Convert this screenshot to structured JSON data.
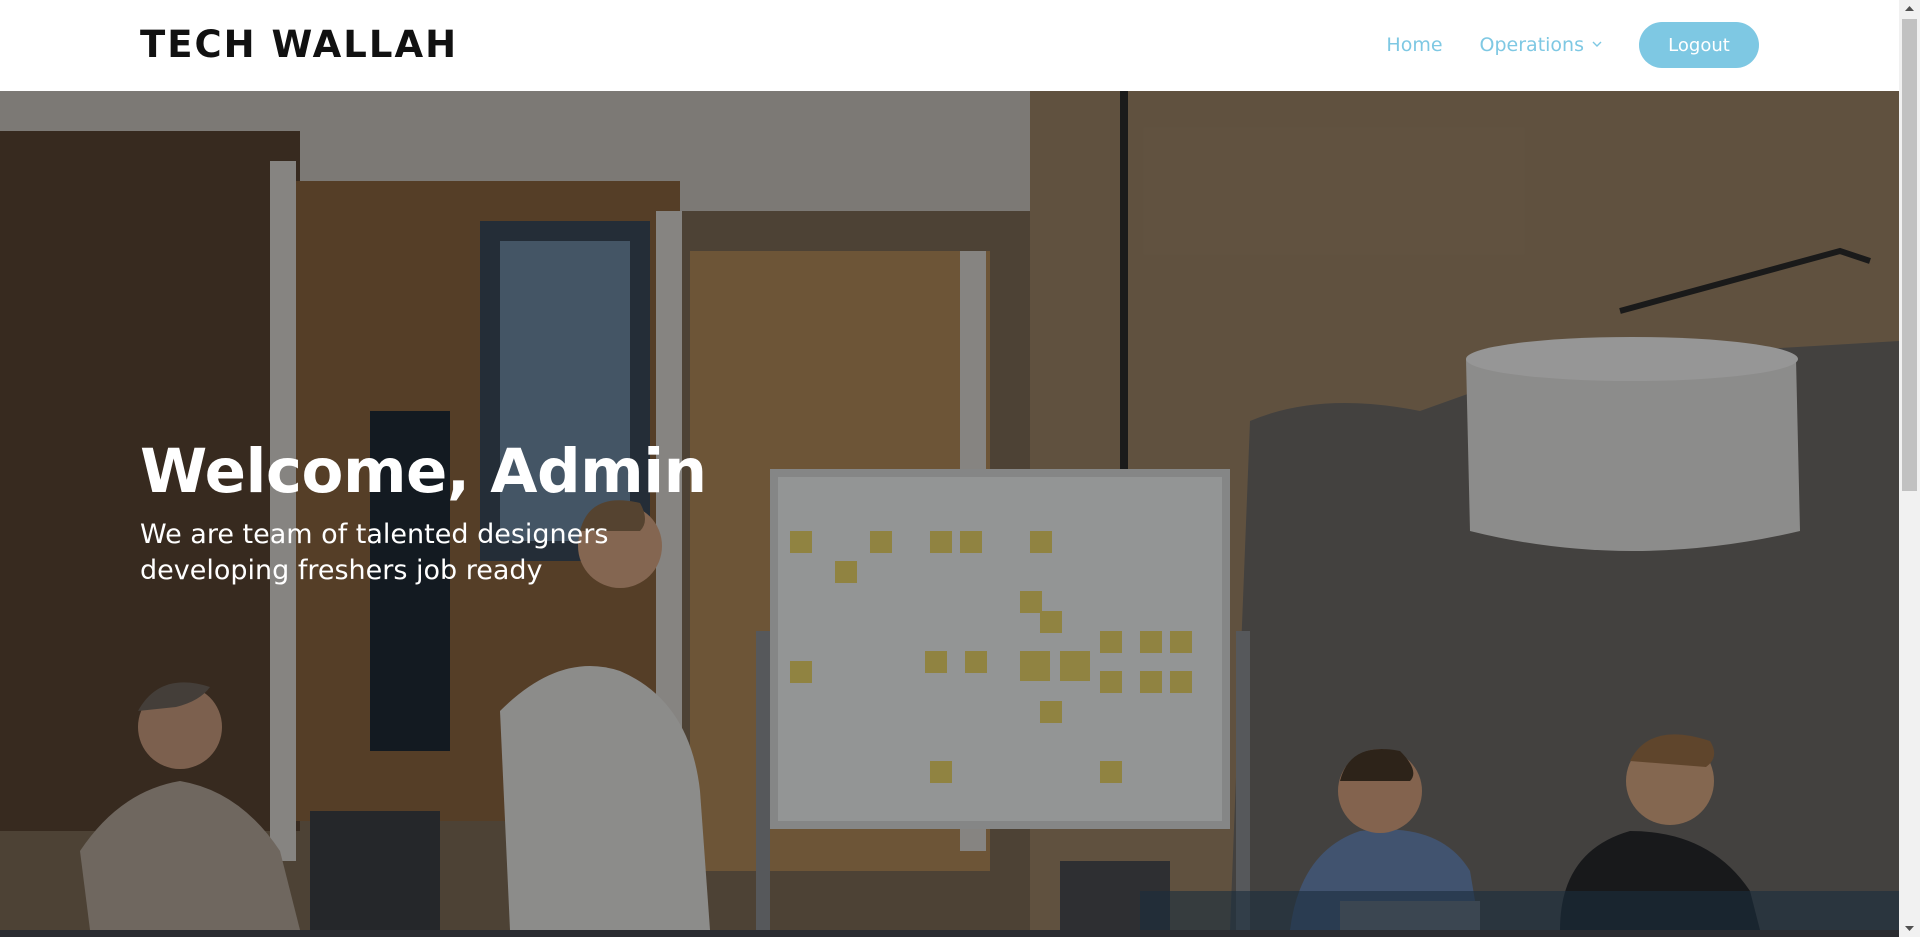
{
  "brand": {
    "name": "TECH WALLAH"
  },
  "nav": {
    "home": "Home",
    "operations": "Operations",
    "logout": "Logout"
  },
  "hero": {
    "title": "Welcome, Admin",
    "subtitle": "We are team of talented designers developing freshers job ready",
    "background": "office team meeting photo"
  },
  "colors": {
    "accent": "#7ec8e3",
    "logo": "#111111",
    "footer": "#2a2c31"
  },
  "icons": {
    "operations_dropdown": "chevron-down-icon",
    "scroll_up": "arrow-up-icon",
    "scroll_down": "arrow-down-icon"
  }
}
